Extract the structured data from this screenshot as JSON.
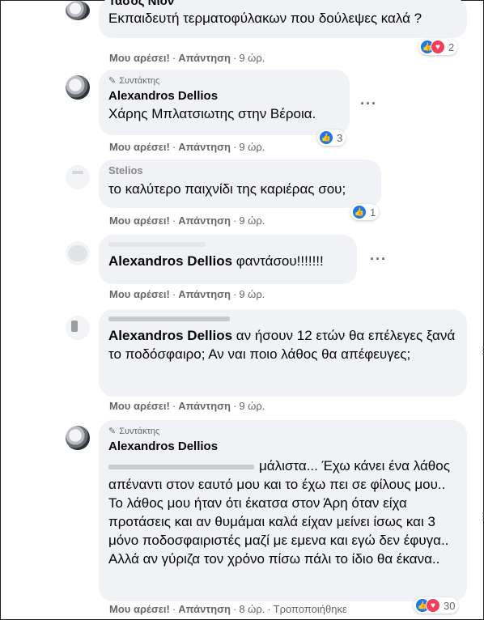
{
  "actions": {
    "like": "Μου αρέσει!",
    "reply": "Απάντηση",
    "separator": "·",
    "edited": "Τροποποιήθηκε"
  },
  "author_badge": "Συντάκτης",
  "comments": [
    {
      "author": "Τάσος Νιον",
      "text": "Εκπαιδευτή τερματοφύλακων που δούλεψες καλά ?",
      "time": "9 ώρ.",
      "reactions": [
        "like",
        "love"
      ],
      "reaction_count": "2"
    },
    {
      "author": "Alexandros Dellios",
      "text": "Χάρης Μπλατσιωτης στην Βέροια.",
      "time": "9 ώρ.",
      "reactions": [
        "like"
      ],
      "reaction_count": "3"
    },
    {
      "author": "Stelios",
      "text": "το καλύτερο παιχνίδι της καριέρας σου;",
      "time": "9 ώρ.",
      "reactions": [
        "like"
      ],
      "reaction_count": "1"
    },
    {
      "mention": "Alexandros Dellios",
      "text": " φαντάσου!!!!!!!",
      "time": "9 ώρ."
    },
    {
      "mention": "Alexandros Dellios",
      "text": " αν ήσουν 12 ετών θα επέλεγες ξανά το ποδόσφαιρο; Αν ναι ποιο λάθος θα απέφευγες;",
      "time": "9 ώρ."
    },
    {
      "author": "Alexandros Dellios",
      "text": "μάλιστα... Έχω κάνει ένα λάθος απέναντι στον εαυτό μου και το έχω πει σε φίλους μου.. Το λάθος μου ήταν ότι έκατσα στον Άρη όταν είχα προτάσεις και αν θυμάμαι καλά είχαν μείνει ίσως και 3 μόνο ποδοσφαιριστές μαζί με εμενα και εγώ δεν έφυγα.. Αλλά αν γύριζα τον χρόνο πίσω πάλι το ίδιο θα έκανα..",
      "time": "8 ώρ.",
      "reactions": [
        "like",
        "love"
      ],
      "reaction_count": "30"
    }
  ]
}
